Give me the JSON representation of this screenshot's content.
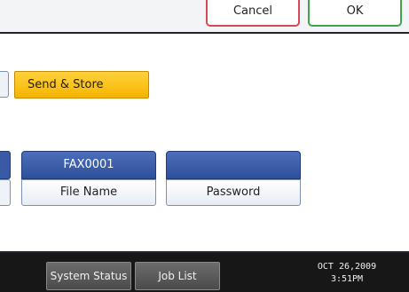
{
  "header": {
    "cancel_label": "Cancel",
    "ok_label": "OK"
  },
  "main": {
    "send_store_label": "Send & Store",
    "destinations": [
      {
        "head": "FAX0001",
        "field": "File Name"
      },
      {
        "head": "",
        "field": "Password"
      }
    ]
  },
  "footer": {
    "system_status_label": "System Status",
    "job_list_label": "Job List",
    "date": "OCT  26,2009",
    "time": "3:51PM"
  },
  "colors": {
    "cancel_border": "#d24a57",
    "ok_border": "#3ea34a",
    "send_store_fill": "#f5b400",
    "dest_head_fill": "#2f4f99",
    "bottom_bar": "#171717"
  }
}
